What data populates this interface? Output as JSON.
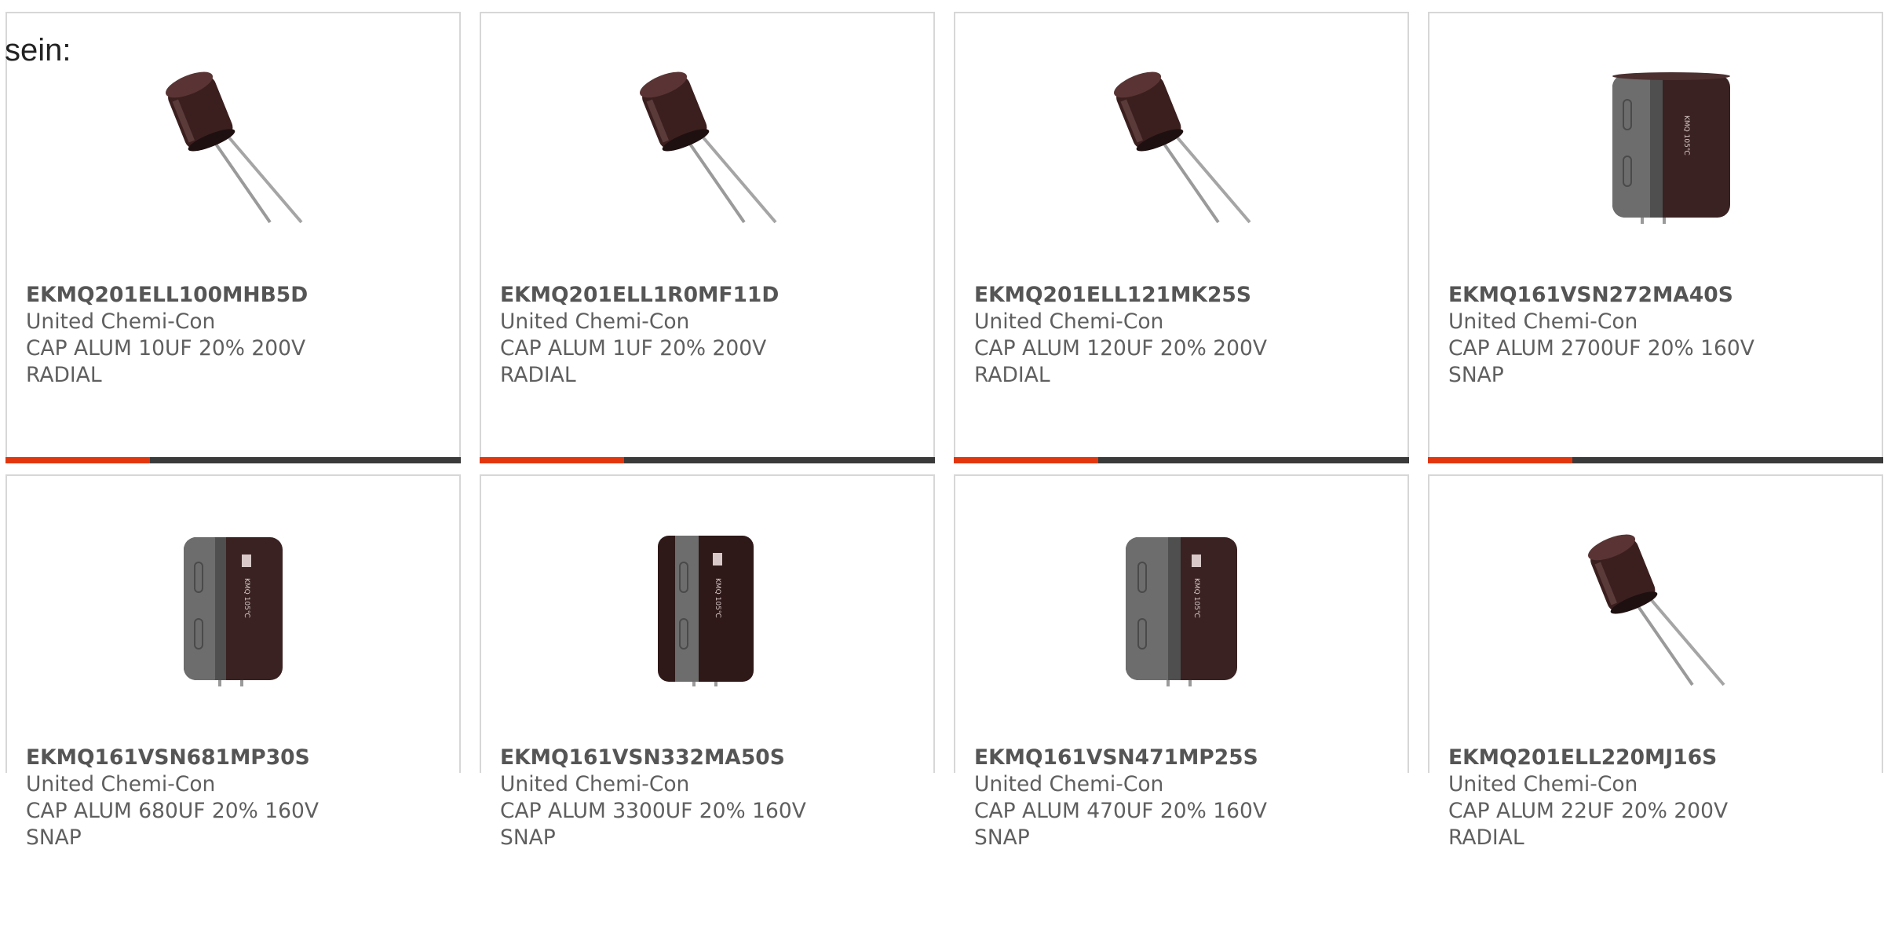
{
  "intro": {
    "text": "sein:"
  },
  "theme": {
    "accent": "#e2360f",
    "bar": "#3a3a3a",
    "text": "#5f5f5f",
    "border": "#d7d7d7"
  },
  "products": [
    {
      "part_number": "EKMQ201ELL100MHB5D",
      "manufacturer": "United Chemi-Con",
      "description": "CAP ALUM 10UF 20% 200V",
      "package": "RADIAL",
      "image": "radial-capacitor-icon"
    },
    {
      "part_number": "EKMQ201ELL1R0MF11D",
      "manufacturer": "United Chemi-Con",
      "description": "CAP ALUM 1UF 20% 200V",
      "package": "RADIAL",
      "image": "radial-capacitor-icon"
    },
    {
      "part_number": "EKMQ201ELL121MK25S",
      "manufacturer": "United Chemi-Con",
      "description": "CAP ALUM 120UF 20% 200V",
      "package": "RADIAL",
      "image": "radial-capacitor-icon"
    },
    {
      "part_number": "EKMQ161VSN272MA40S",
      "manufacturer": "United Chemi-Con",
      "description": "CAP ALUM 2700UF 20% 160V",
      "package": "SNAP",
      "image": "snap-in-capacitor-icon"
    },
    {
      "part_number": "EKMQ161VSN681MP30S",
      "manufacturer": "United Chemi-Con",
      "description": "CAP ALUM 680UF 20% 160V",
      "package": "SNAP",
      "image": "snap-in-capacitor-icon"
    },
    {
      "part_number": "EKMQ161VSN332MA50S",
      "manufacturer": "United Chemi-Con",
      "description": "CAP ALUM 3300UF 20% 160V",
      "package": "SNAP",
      "image": "snap-in-capacitor-icon"
    },
    {
      "part_number": "EKMQ161VSN471MP25S",
      "manufacturer": "United Chemi-Con",
      "description": "CAP ALUM 470UF 20% 160V",
      "package": "SNAP",
      "image": "snap-in-capacitor-icon"
    },
    {
      "part_number": "EKMQ201ELL220MJ16S",
      "manufacturer": "United Chemi-Con",
      "description": "CAP ALUM 22UF 20% 200V",
      "package": "RADIAL",
      "image": "radial-capacitor-icon"
    }
  ]
}
